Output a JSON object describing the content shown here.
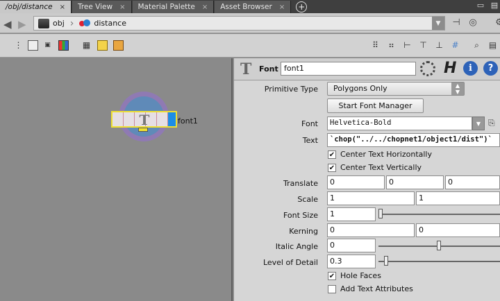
{
  "tabs": [
    {
      "label": "/obj/distance",
      "active": true
    },
    {
      "label": "Tree View",
      "active": false
    },
    {
      "label": "Material Palette",
      "active": false
    },
    {
      "label": "Asset Browser",
      "active": false
    }
  ],
  "tab_close_glyph": "×",
  "path": {
    "crumbs": [
      "obj",
      "distance"
    ]
  },
  "network": {
    "node_label": "font1",
    "node_icon_glyph": "T"
  },
  "params": {
    "node_type": "Font",
    "node_name": "font1",
    "help_glyph": "?",
    "info_glyph": "i",
    "h_glyph": "H",
    "primitive_type_label": "Primitive Type",
    "primitive_type_value": "Polygons Only",
    "start_font_manager": "Start Font Manager",
    "font_label": "Font",
    "font_value": "Helvetica-Bold",
    "text_label": "Text",
    "text_value": "`chop(\"../../chopnet1/object1/dist\")`",
    "center_h_label": "Center Text Horizontally",
    "center_h_checked": true,
    "center_v_label": "Center Text Vertically",
    "center_v_checked": true,
    "translate_label": "Translate",
    "translate_values": [
      "0",
      "0",
      "0"
    ],
    "scale_label": "Scale",
    "scale_values": [
      "1",
      "1"
    ],
    "font_size_label": "Font Size",
    "font_size_value": "1",
    "kerning_label": "Kerning",
    "kerning_values": [
      "0",
      "0"
    ],
    "italic_angle_label": "Italic Angle",
    "italic_angle_value": "0",
    "lod_label": "Level of Detail",
    "lod_value": "0.3",
    "hole_faces_label": "Hole Faces",
    "hole_faces_checked": true,
    "add_text_attrs_label": "Add Text Attributes",
    "add_text_attrs_checked": false,
    "check_glyph": "✔"
  },
  "colors": {
    "node_select": "#f0e030",
    "node_flag": "#1c8ee6",
    "info_blue": "#2d62b8"
  }
}
